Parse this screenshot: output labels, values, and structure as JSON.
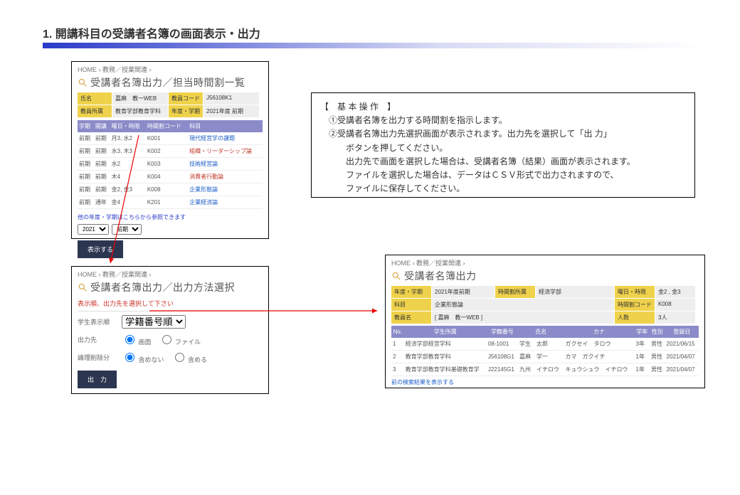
{
  "page_title": "1. 開講科目の受講者名簿の画面表示・出力",
  "instructions": {
    "header": "【　基 本 操 作　】",
    "l1": "①受講者名簿を出力する時間割を指示します。",
    "l2": "②受講者名簿出力先選択画面が表示されます。出力先を選択して「出 力」",
    "l3": "　ボタンを押してください。",
    "l4": "　出力先で画面を選択した場合は、受講者名簿（結果）画面が表示されます。",
    "l5": "　ファイルを選択した場合は、データはＣＳＶ形式で出力されますので、",
    "l6": "　ファイルに保存してください。"
  },
  "p1": {
    "breadcrumb": "HOME  ›  教務／授業関連  ›",
    "title": "受講者名簿出力／担当時間割一覧",
    "row1": {
      "k1": "氏名",
      "v1": "嘉麻　教一WEB",
      "k2": "教員コード",
      "v2": "J56108K1"
    },
    "row2": {
      "k1": "教員所属",
      "v1": "教育学部教育学科",
      "k2": "年度・学期",
      "v2": "2021年度 前期"
    },
    "th": [
      "学期",
      "開講",
      "曜日・時限",
      "時間割コード",
      "科目"
    ],
    "rows": [
      [
        "前期",
        "前期",
        "月3, 水2",
        "K001",
        "現代経営学の課題",
        "link"
      ],
      [
        "前期",
        "前期",
        "水3, 木3",
        "K002",
        "組織・リーダーシップ論",
        "linkred"
      ],
      [
        "前期",
        "前期",
        "水2",
        "K003",
        "技術経営論",
        "link"
      ],
      [
        "前期",
        "前期",
        "木4",
        "K004",
        "消費者行動論",
        "linkred"
      ],
      [
        "前期",
        "前期",
        "金2, 金3",
        "K008",
        "企業形態論",
        "link"
      ],
      [
        "前期",
        "通年",
        "金4",
        "K201",
        "企業経済論",
        "link"
      ]
    ],
    "note": "他の年度・学期はこちらから参照できます",
    "year": "2021",
    "term": "前期",
    "btn": "表示する"
  },
  "p2": {
    "breadcrumb": "HOME  ›  教務／授業関連  ›",
    "title": "受講者名簿出力／出力方法選択",
    "red": "表示順、出力先を選択して下さい",
    "f1": {
      "label": "学生表示順",
      "opt": "学籍番号順"
    },
    "f2": {
      "label": "出力先",
      "r1": "画面",
      "r2": "ファイル"
    },
    "f3": {
      "label": "論理削除分",
      "r1": "含めない",
      "r2": "含める"
    },
    "btn": "出　力"
  },
  "p3": {
    "breadcrumb": "HOME  ›  教務／授業関連  ›",
    "title": "受講者名簿出力",
    "row1": {
      "k1": "年度・学期",
      "v1": "2021年度前期",
      "k2": "時間割所属",
      "v2": "経済学部",
      "k3": "曜日・時限",
      "v3": "金2 , 金3"
    },
    "row2": {
      "k1": "科目",
      "v1": "企業形態論",
      "k3": "時間割コード",
      "v3": "K008"
    },
    "row3": {
      "k1": "教員名",
      "v1": "[ 嘉麻　教一WEB ]",
      "k3": "人数",
      "v3": "3人"
    },
    "th": [
      "No.",
      "学生所属",
      "学籍番号",
      "氏名",
      "カナ",
      "学年",
      "性別",
      "登録日"
    ],
    "rows": [
      [
        "1",
        "経済学部経営学科",
        "08-1001",
        "学生　太郎",
        "ガクセイ　タロウ",
        "3年",
        "男性",
        "2021/06/15"
      ],
      [
        "2",
        "教育学部教育学科",
        "J56108G1",
        "嘉麻　学一",
        "カマ　ガクイチ",
        "1年",
        "男性",
        "2021/04/07"
      ],
      [
        "3",
        "教育学部教育学科基礎教育学",
        "J22145G1",
        "九州　イチロウ",
        "キュウシュウ　イチロウ",
        "1年",
        "男性",
        "2021/04/07"
      ]
    ],
    "footer": "前の検索結果を表示する"
  }
}
